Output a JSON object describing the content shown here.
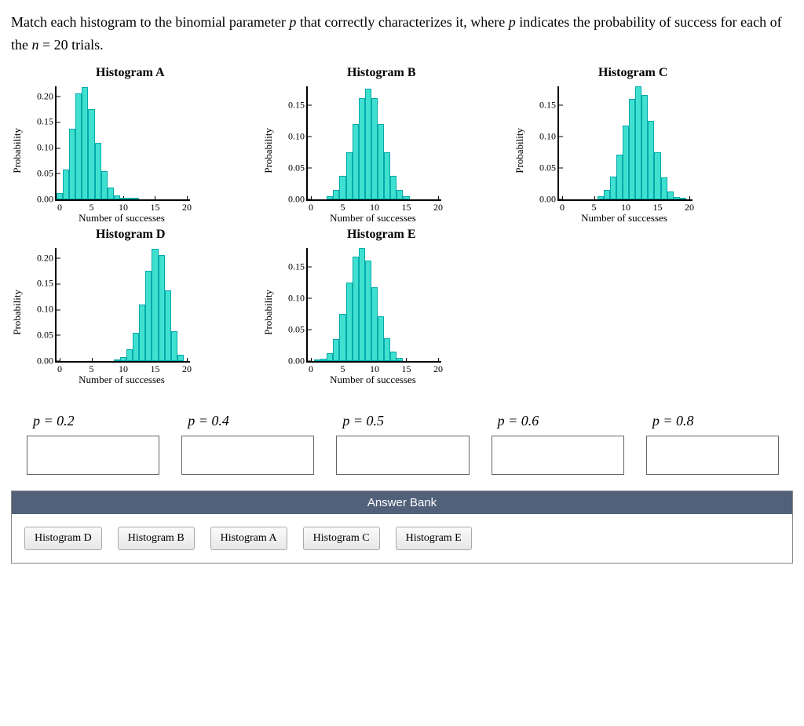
{
  "question_p1": "Match each histogram to the binomial parameter ",
  "question_p_var": "p",
  "question_p2": " that correctly characterizes it, where ",
  "question_p3": " indicates the probability of success for each of the ",
  "question_n_expr": "n = 20",
  "question_p4": " trials.",
  "xlabel": "Number of successes",
  "ylabel": "Probability",
  "xTicks": [
    0,
    5,
    10,
    15,
    20
  ],
  "charts": [
    {
      "id": "A",
      "title": "Histogram A",
      "yticks": [
        0.0,
        0.05,
        0.1,
        0.15,
        0.2
      ],
      "ymax": 0.22,
      "values": [
        0.0115,
        0.0576,
        0.1369,
        0.2054,
        0.2182,
        0.1746,
        0.1091,
        0.0545,
        0.0222,
        0.0074,
        0.002,
        0.0005,
        0.0001,
        0,
        0,
        0,
        0,
        0,
        0,
        0,
        0
      ]
    },
    {
      "id": "B",
      "title": "Histogram B",
      "yticks": [
        0.0,
        0.05,
        0.1,
        0.15
      ],
      "ymax": 0.18,
      "values": [
        0,
        0,
        0,
        0.004,
        0.0139,
        0.0365,
        0.0739,
        0.1201,
        0.1602,
        0.1762,
        0.1602,
        0.1201,
        0.0739,
        0.0365,
        0.0139,
        0.004,
        0,
        0,
        0,
        0,
        0
      ]
    },
    {
      "id": "C",
      "title": "Histogram C",
      "yticks": [
        0.0,
        0.05,
        0.1,
        0.15
      ],
      "ymax": 0.18,
      "values": [
        0,
        0,
        0,
        0,
        0,
        0,
        0.0049,
        0.0146,
        0.0355,
        0.071,
        0.1171,
        0.1597,
        0.1797,
        0.1659,
        0.1244,
        0.0746,
        0.035,
        0.0123,
        0.0031,
        0.0005,
        0
      ]
    },
    {
      "id": "D",
      "title": "Histogram D",
      "yticks": [
        0.0,
        0.05,
        0.1,
        0.15,
        0.2
      ],
      "ymax": 0.22,
      "values": [
        0,
        0,
        0,
        0,
        0,
        0,
        0,
        0,
        0,
        0.002,
        0.0074,
        0.0222,
        0.0545,
        0.1091,
        0.1746,
        0.2182,
        0.2054,
        0.1369,
        0.0576,
        0.0115,
        0
      ]
    },
    {
      "id": "E",
      "title": "Histogram E",
      "yticks": [
        0.0,
        0.05,
        0.1,
        0.15
      ],
      "ymax": 0.18,
      "values": [
        0,
        0.0005,
        0.0031,
        0.0123,
        0.035,
        0.0746,
        0.1244,
        0.1659,
        0.1797,
        0.1597,
        0.1171,
        0.071,
        0.0355,
        0.0146,
        0.0049,
        0,
        0,
        0,
        0,
        0,
        0
      ]
    }
  ],
  "dropLabels": [
    "p = 0.2",
    "p = 0.4",
    "p = 0.5",
    "p = 0.6",
    "p = 0.8"
  ],
  "bankTitle": "Answer Bank",
  "bankItems": [
    "Histogram D",
    "Histogram B",
    "Histogram A",
    "Histogram C",
    "Histogram E"
  ],
  "chart_data": [
    {
      "type": "bar",
      "title": "Histogram A",
      "xlabel": "Number of successes",
      "ylabel": "Probability",
      "ylim": [
        0,
        0.22
      ],
      "categories": [
        0,
        1,
        2,
        3,
        4,
        5,
        6,
        7,
        8,
        9,
        10,
        11,
        12,
        13,
        14,
        15,
        16,
        17,
        18,
        19,
        20
      ],
      "values": [
        0.0115,
        0.0576,
        0.1369,
        0.2054,
        0.2182,
        0.1746,
        0.1091,
        0.0545,
        0.0222,
        0.0074,
        0.002,
        0.0005,
        0.0001,
        0,
        0,
        0,
        0,
        0,
        0,
        0,
        0
      ]
    },
    {
      "type": "bar",
      "title": "Histogram B",
      "xlabel": "Number of successes",
      "ylabel": "Probability",
      "ylim": [
        0,
        0.18
      ],
      "categories": [
        0,
        1,
        2,
        3,
        4,
        5,
        6,
        7,
        8,
        9,
        10,
        11,
        12,
        13,
        14,
        15,
        16,
        17,
        18,
        19,
        20
      ],
      "values": [
        0,
        0,
        0,
        0.004,
        0.0139,
        0.0365,
        0.0739,
        0.1201,
        0.1602,
        0.1762,
        0.1602,
        0.1201,
        0.0739,
        0.0365,
        0.0139,
        0.004,
        0,
        0,
        0,
        0,
        0
      ]
    },
    {
      "type": "bar",
      "title": "Histogram C",
      "xlabel": "Number of successes",
      "ylabel": "Probability",
      "ylim": [
        0,
        0.18
      ],
      "categories": [
        0,
        1,
        2,
        3,
        4,
        5,
        6,
        7,
        8,
        9,
        10,
        11,
        12,
        13,
        14,
        15,
        16,
        17,
        18,
        19,
        20
      ],
      "values": [
        0,
        0,
        0,
        0,
        0,
        0,
        0.0049,
        0.0146,
        0.0355,
        0.071,
        0.1171,
        0.1597,
        0.1797,
        0.1659,
        0.1244,
        0.0746,
        0.035,
        0.0123,
        0.0031,
        0.0005,
        0
      ]
    },
    {
      "type": "bar",
      "title": "Histogram D",
      "xlabel": "Number of successes",
      "ylabel": "Probability",
      "ylim": [
        0,
        0.22
      ],
      "categories": [
        0,
        1,
        2,
        3,
        4,
        5,
        6,
        7,
        8,
        9,
        10,
        11,
        12,
        13,
        14,
        15,
        16,
        17,
        18,
        19,
        20
      ],
      "values": [
        0,
        0,
        0,
        0,
        0,
        0,
        0,
        0,
        0,
        0.002,
        0.0074,
        0.0222,
        0.0545,
        0.1091,
        0.1746,
        0.2182,
        0.2054,
        0.1369,
        0.0576,
        0.0115,
        0
      ]
    },
    {
      "type": "bar",
      "title": "Histogram E",
      "xlabel": "Number of successes",
      "ylabel": "Probability",
      "ylim": [
        0,
        0.18
      ],
      "categories": [
        0,
        1,
        2,
        3,
        4,
        5,
        6,
        7,
        8,
        9,
        10,
        11,
        12,
        13,
        14,
        15,
        16,
        17,
        18,
        19,
        20
      ],
      "values": [
        0,
        0.0005,
        0.0031,
        0.0123,
        0.035,
        0.0746,
        0.1244,
        0.1659,
        0.1797,
        0.1597,
        0.1171,
        0.071,
        0.0355,
        0.0146,
        0.0049,
        0,
        0,
        0,
        0,
        0,
        0
      ]
    }
  ]
}
